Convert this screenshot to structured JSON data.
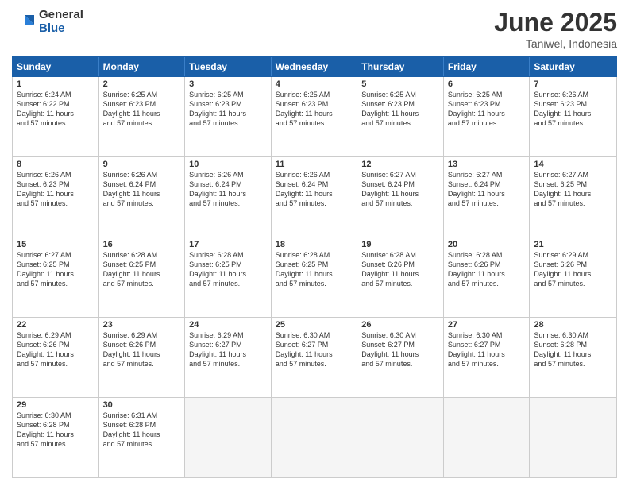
{
  "logo": {
    "line1": "General",
    "line2": "Blue"
  },
  "title": "June 2025",
  "location": "Taniwel, Indonesia",
  "header_days": [
    "Sunday",
    "Monday",
    "Tuesday",
    "Wednesday",
    "Thursday",
    "Friday",
    "Saturday"
  ],
  "weeks": [
    [
      {
        "day": "1",
        "lines": [
          "Sunrise: 6:24 AM",
          "Sunset: 6:22 PM",
          "Daylight: 11 hours",
          "and 57 minutes."
        ]
      },
      {
        "day": "2",
        "lines": [
          "Sunrise: 6:25 AM",
          "Sunset: 6:23 PM",
          "Daylight: 11 hours",
          "and 57 minutes."
        ]
      },
      {
        "day": "3",
        "lines": [
          "Sunrise: 6:25 AM",
          "Sunset: 6:23 PM",
          "Daylight: 11 hours",
          "and 57 minutes."
        ]
      },
      {
        "day": "4",
        "lines": [
          "Sunrise: 6:25 AM",
          "Sunset: 6:23 PM",
          "Daylight: 11 hours",
          "and 57 minutes."
        ]
      },
      {
        "day": "5",
        "lines": [
          "Sunrise: 6:25 AM",
          "Sunset: 6:23 PM",
          "Daylight: 11 hours",
          "and 57 minutes."
        ]
      },
      {
        "day": "6",
        "lines": [
          "Sunrise: 6:25 AM",
          "Sunset: 6:23 PM",
          "Daylight: 11 hours",
          "and 57 minutes."
        ]
      },
      {
        "day": "7",
        "lines": [
          "Sunrise: 6:26 AM",
          "Sunset: 6:23 PM",
          "Daylight: 11 hours",
          "and 57 minutes."
        ]
      }
    ],
    [
      {
        "day": "8",
        "lines": [
          "Sunrise: 6:26 AM",
          "Sunset: 6:23 PM",
          "Daylight: 11 hours",
          "and 57 minutes."
        ]
      },
      {
        "day": "9",
        "lines": [
          "Sunrise: 6:26 AM",
          "Sunset: 6:24 PM",
          "Daylight: 11 hours",
          "and 57 minutes."
        ]
      },
      {
        "day": "10",
        "lines": [
          "Sunrise: 6:26 AM",
          "Sunset: 6:24 PM",
          "Daylight: 11 hours",
          "and 57 minutes."
        ]
      },
      {
        "day": "11",
        "lines": [
          "Sunrise: 6:26 AM",
          "Sunset: 6:24 PM",
          "Daylight: 11 hours",
          "and 57 minutes."
        ]
      },
      {
        "day": "12",
        "lines": [
          "Sunrise: 6:27 AM",
          "Sunset: 6:24 PM",
          "Daylight: 11 hours",
          "and 57 minutes."
        ]
      },
      {
        "day": "13",
        "lines": [
          "Sunrise: 6:27 AM",
          "Sunset: 6:24 PM",
          "Daylight: 11 hours",
          "and 57 minutes."
        ]
      },
      {
        "day": "14",
        "lines": [
          "Sunrise: 6:27 AM",
          "Sunset: 6:25 PM",
          "Daylight: 11 hours",
          "and 57 minutes."
        ]
      }
    ],
    [
      {
        "day": "15",
        "lines": [
          "Sunrise: 6:27 AM",
          "Sunset: 6:25 PM",
          "Daylight: 11 hours",
          "and 57 minutes."
        ]
      },
      {
        "day": "16",
        "lines": [
          "Sunrise: 6:28 AM",
          "Sunset: 6:25 PM",
          "Daylight: 11 hours",
          "and 57 minutes."
        ]
      },
      {
        "day": "17",
        "lines": [
          "Sunrise: 6:28 AM",
          "Sunset: 6:25 PM",
          "Daylight: 11 hours",
          "and 57 minutes."
        ]
      },
      {
        "day": "18",
        "lines": [
          "Sunrise: 6:28 AM",
          "Sunset: 6:25 PM",
          "Daylight: 11 hours",
          "and 57 minutes."
        ]
      },
      {
        "day": "19",
        "lines": [
          "Sunrise: 6:28 AM",
          "Sunset: 6:26 PM",
          "Daylight: 11 hours",
          "and 57 minutes."
        ]
      },
      {
        "day": "20",
        "lines": [
          "Sunrise: 6:28 AM",
          "Sunset: 6:26 PM",
          "Daylight: 11 hours",
          "and 57 minutes."
        ]
      },
      {
        "day": "21",
        "lines": [
          "Sunrise: 6:29 AM",
          "Sunset: 6:26 PM",
          "Daylight: 11 hours",
          "and 57 minutes."
        ]
      }
    ],
    [
      {
        "day": "22",
        "lines": [
          "Sunrise: 6:29 AM",
          "Sunset: 6:26 PM",
          "Daylight: 11 hours",
          "and 57 minutes."
        ]
      },
      {
        "day": "23",
        "lines": [
          "Sunrise: 6:29 AM",
          "Sunset: 6:26 PM",
          "Daylight: 11 hours",
          "and 57 minutes."
        ]
      },
      {
        "day": "24",
        "lines": [
          "Sunrise: 6:29 AM",
          "Sunset: 6:27 PM",
          "Daylight: 11 hours",
          "and 57 minutes."
        ]
      },
      {
        "day": "25",
        "lines": [
          "Sunrise: 6:30 AM",
          "Sunset: 6:27 PM",
          "Daylight: 11 hours",
          "and 57 minutes."
        ]
      },
      {
        "day": "26",
        "lines": [
          "Sunrise: 6:30 AM",
          "Sunset: 6:27 PM",
          "Daylight: 11 hours",
          "and 57 minutes."
        ]
      },
      {
        "day": "27",
        "lines": [
          "Sunrise: 6:30 AM",
          "Sunset: 6:27 PM",
          "Daylight: 11 hours",
          "and 57 minutes."
        ]
      },
      {
        "day": "28",
        "lines": [
          "Sunrise: 6:30 AM",
          "Sunset: 6:28 PM",
          "Daylight: 11 hours",
          "and 57 minutes."
        ]
      }
    ],
    [
      {
        "day": "29",
        "lines": [
          "Sunrise: 6:30 AM",
          "Sunset: 6:28 PM",
          "Daylight: 11 hours",
          "and 57 minutes."
        ]
      },
      {
        "day": "30",
        "lines": [
          "Sunrise: 6:31 AM",
          "Sunset: 6:28 PM",
          "Daylight: 11 hours",
          "and 57 minutes."
        ]
      },
      {
        "day": "",
        "lines": []
      },
      {
        "day": "",
        "lines": []
      },
      {
        "day": "",
        "lines": []
      },
      {
        "day": "",
        "lines": []
      },
      {
        "day": "",
        "lines": []
      }
    ]
  ]
}
